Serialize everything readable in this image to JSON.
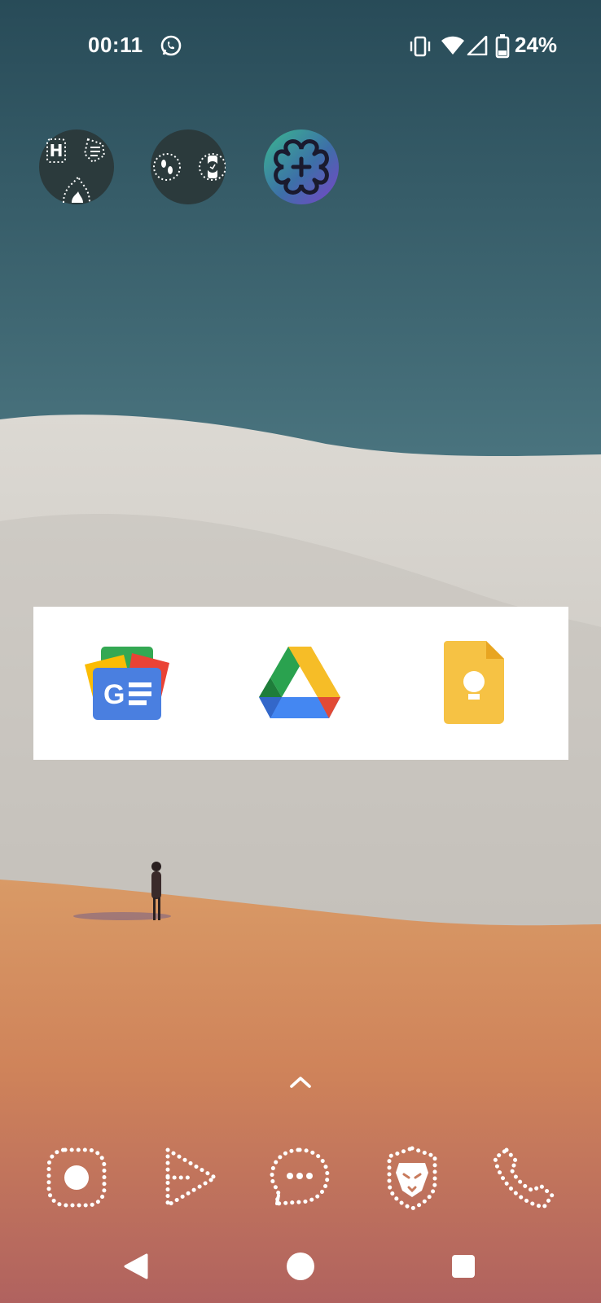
{
  "status_bar": {
    "time": "00:11",
    "battery_percent": "24%",
    "left_icons": [
      "whatsapp-icon"
    ],
    "right_icons": [
      "vibrate-icon",
      "wifi-icon",
      "cell-signal-icon",
      "battery-icon"
    ]
  },
  "widgets": [
    {
      "name": "fitness-widget",
      "icons": [
        "h-icon",
        "list-icon",
        "flame-icon"
      ]
    },
    {
      "name": "watch-widget",
      "icons": [
        "footsteps-icon",
        "watch-icon"
      ]
    },
    {
      "name": "round-app-icon",
      "icons": [
        "knot-icon"
      ]
    }
  ],
  "shortcut_card": {
    "apps": [
      "google-news-icon",
      "google-drive-icon",
      "google-keep-icon"
    ]
  },
  "dock": {
    "apps": [
      "camera-icon",
      "play-icon",
      "messages-icon",
      "brave-lion-icon",
      "phone-icon"
    ]
  },
  "nav_bar": {
    "buttons": [
      "back-button",
      "home-button",
      "recents-button"
    ]
  },
  "colors": {
    "sky_top": "#2a4e5a",
    "sky_bottom": "#8ab0bb",
    "dune_white": "#cfcbc4",
    "sand_orange": "#d08a57",
    "sand_red": "#b3625c",
    "widget_dark": "#2b3a3c",
    "news_blue": "#4a7fe0",
    "drive_green": "#2aa24f",
    "drive_yellow": "#f6bd27",
    "drive_blue": "#4487f2",
    "drive_red": "#e14a36",
    "keep_yellow": "#f6c244"
  }
}
